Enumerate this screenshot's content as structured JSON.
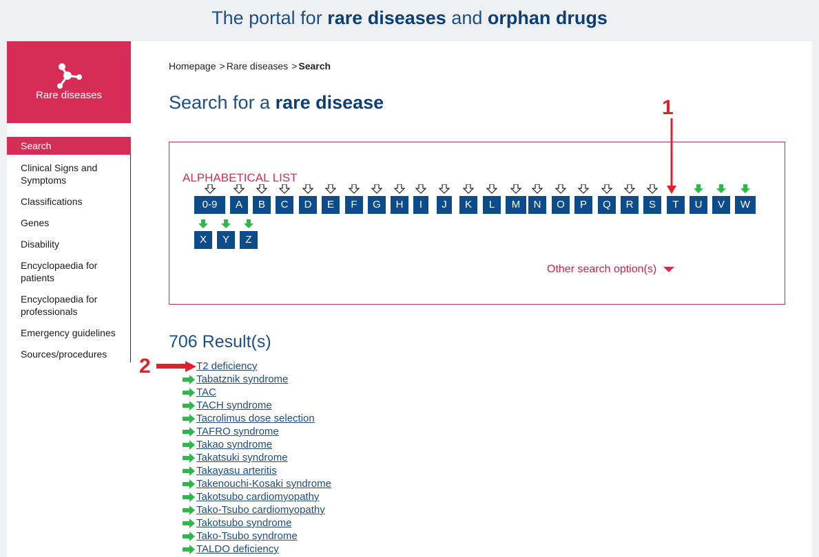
{
  "header": {
    "prefix": "The portal for ",
    "bold1": "rare diseases",
    "mid": " and ",
    "bold2": "orphan drugs"
  },
  "logo": {
    "label": "Rare diseases",
    "icon": "molecule-icon"
  },
  "sidebar": {
    "items": [
      {
        "label": "Search",
        "active": true
      },
      {
        "label": "Clinical Signs and Symptoms"
      },
      {
        "label": "Classifications"
      },
      {
        "label": "Genes"
      },
      {
        "label": "Disability"
      },
      {
        "label": "Encyclopaedia for patients"
      },
      {
        "label": "Encyclopaedia for professionals"
      },
      {
        "label": "Emergency guidelines"
      },
      {
        "label": "Sources/procedures"
      }
    ]
  },
  "breadcrumb": {
    "home": "Homepage",
    "section": "Rare diseases",
    "current": "Search"
  },
  "title": {
    "prefix": "Search for a ",
    "bold": "rare disease"
  },
  "alphabetical": {
    "title": "ALPHABETICAL LIST",
    "letters": [
      "0-9",
      "A",
      "B",
      "C",
      "D",
      "E",
      "F",
      "G",
      "H",
      "I",
      "J",
      "K",
      "L",
      "M",
      "N",
      "O",
      "P",
      "Q",
      "R",
      "S",
      "T",
      "U",
      "V",
      "W",
      "X",
      "Y",
      "Z"
    ],
    "arrow_styles": {
      "outline": [
        "0-9",
        "A",
        "B",
        "C",
        "D",
        "E",
        "F",
        "G",
        "H",
        "I",
        "J",
        "K",
        "L",
        "M",
        "N",
        "O",
        "P",
        "Q",
        "R",
        "S"
      ],
      "green": [
        "U",
        "V",
        "W",
        "X",
        "Y",
        "Z"
      ]
    },
    "other_options": "Other search option(s)"
  },
  "results": {
    "count": "706 Result(s)",
    "items": [
      "T2 deficiency",
      "Tabatznik syndrome",
      "TAC",
      "TACH syndrome",
      "Tacrolimus dose selection",
      "TAFRO syndrome",
      "Takao syndrome",
      "Takatsuki syndrome",
      "Takayasu arteritis",
      "Takenouchi-Kosaki syndrome",
      "Takotsubo cardiomyopathy",
      "Tako-Tsubo cardiomyopathy",
      "Takotsubo syndrome",
      "Tako-Tsubo syndrome",
      "TALDO deficiency"
    ]
  },
  "annotations": {
    "one": "1",
    "two": "2"
  },
  "colors": {
    "accent": "#d62c55",
    "letter_bg": "#0d4c8a",
    "link": "#1e4c7c",
    "green_arrow": "#2db84a",
    "red_annotation": "#e0202a"
  }
}
